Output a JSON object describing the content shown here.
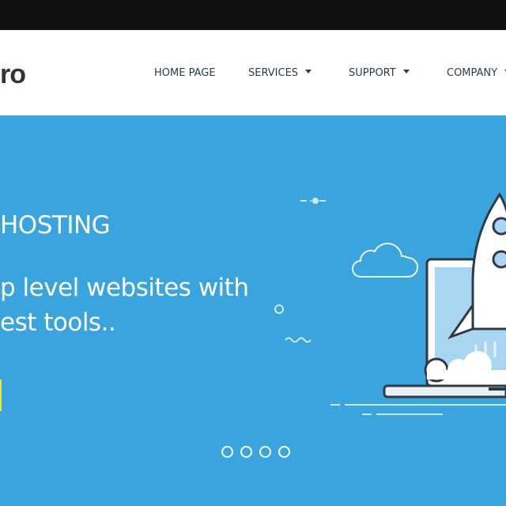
{
  "brand": {
    "logo_text": "ro"
  },
  "nav": {
    "items": [
      {
        "label": "HOME PAGE",
        "has_dropdown": false
      },
      {
        "label": "SERVICES",
        "has_dropdown": true
      },
      {
        "label": "SUPPORT",
        "has_dropdown": true
      },
      {
        "label": "COMPANY",
        "has_dropdown": true
      }
    ]
  },
  "hero": {
    "title": "HOSTING",
    "subtitle_line1": "p level websites with",
    "subtitle_line2": "est tools..",
    "slider_count": 4
  },
  "colors": {
    "hero_bg": "#3aa4de",
    "top_bar": "#111111",
    "nav_text": "#2d3b45",
    "accent_button": "#e6e64a"
  },
  "icons": [
    "rocket-icon",
    "laptop-icon",
    "cloud-icon",
    "chevron-down-icon"
  ]
}
